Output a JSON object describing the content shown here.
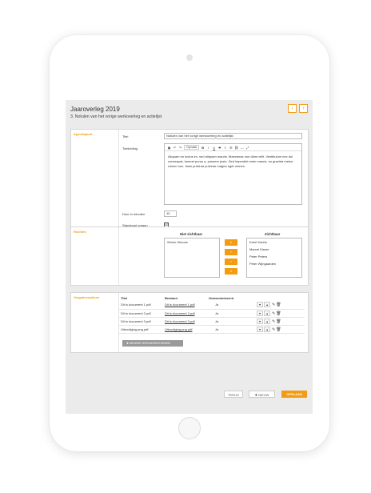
{
  "header": {
    "title": "Jaaroverleg 2019",
    "subtitle": "3. Notulen van het vorige werkoverleg en actielijst",
    "prev_label": "‹",
    "next_label": "›"
  },
  "agendapunt": {
    "section_label": "Agendapunt",
    "title_label": "Titel",
    "title_value": "Notulen van het vorige werkoverleg en actielijst",
    "toelichting_label": "Toelichting",
    "toolbar": {
      "format_label": "Opmaak",
      "bold": "B",
      "italic": "I",
      "underline": "U",
      "strike": "S"
    },
    "body_text": "Aliquam eu luctus ex, sed aliquam mauris. Maecenas non diam velit. Vestibulum nec dui consequat, laoreet purus a, posuere justo. Sed imperdiet enim mauris, eu gravida metus rutrum non. Nam pulvinar pulvinar magna eget viverra.",
    "duur_label": "Duur in minuten",
    "duur_value": "10",
    "standpunt_label": "Standpunt vragen",
    "standpunt_checked": "☑"
  },
  "rechten": {
    "section_label": "Rechten",
    "niet_zichtbaar_label": "Niet zichtbaar",
    "niet_zichtbaar_items": [
      "Simon Simons"
    ],
    "zichtbaar_label": "Zichtbaar",
    "zichtbaar_items": [
      "Karel Karels",
      "Marcel Klaver",
      "Peter Peters",
      "Peter Wijngaarden"
    ],
    "move_all_right": "»",
    "move_right": "›",
    "move_left": "‹",
    "move_all_left": "«"
  },
  "vergaderstukken": {
    "section_label": "Vergaderstukken",
    "columns": [
      "Titel",
      "Bestand",
      "Geanonimiseerd"
    ],
    "rows": [
      {
        "titel": "Dit is document 1.pdf",
        "bestand": "Dit is document 1.pdf",
        "geanonimiseerd": "Ja"
      },
      {
        "titel": "Dit is document 2.pdf",
        "bestand": "Dit is document 2.pdf",
        "geanonimiseerd": "Ja"
      },
      {
        "titel": "Dit is document 3.pdf",
        "bestand": "Dit is document 3.pdf",
        "geanonimiseerd": "Ja"
      },
      {
        "titel": "Uitnodiging.png.pdf",
        "bestand": "Uitnodiging.png.pdf",
        "geanonimiseerd": "Ja"
      }
    ],
    "add_button": "NIEUWE VERGADERSTUKKEN"
  },
  "footer": {
    "terug": "TERUG",
    "nieuw": "NIEUW",
    "opslaan": "OPSLAAN"
  },
  "colors": {
    "accent": "#f39c12",
    "panel_bg": "#ffffff",
    "screen_bg": "#ebebeb"
  }
}
